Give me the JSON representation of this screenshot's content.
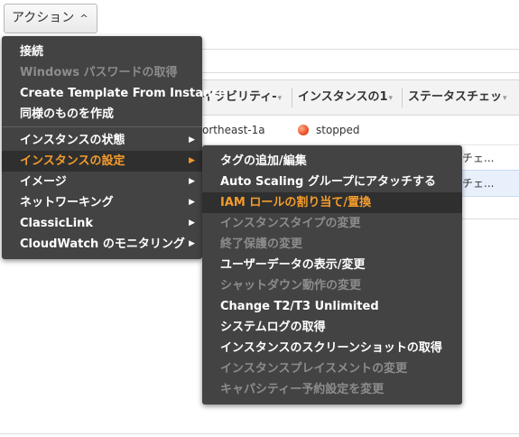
{
  "action_button": {
    "label": "アクション",
    "caret": "^"
  },
  "table": {
    "headers": [
      {
        "label": "イラビリティ-",
        "sort": "▾"
      },
      {
        "label": "インスタンスの1",
        "sort": "▾"
      },
      {
        "label": "ステータスチェッ",
        "sort": "▾"
      }
    ],
    "rows": [
      {
        "zone": "ortheast-1a",
        "state": "stopped",
        "status": ""
      },
      {
        "zone": "",
        "state": "",
        "status": "チェ..."
      },
      {
        "zone": "",
        "state": "",
        "status": "チェ..."
      }
    ]
  },
  "main_menu": {
    "items": [
      {
        "label": "接続",
        "enabled": true,
        "submenu": false
      },
      {
        "label": "Windows パスワードの取得",
        "enabled": false,
        "submenu": false
      },
      {
        "label": "Create Template From Instance",
        "enabled": true,
        "submenu": false
      },
      {
        "label": "同様のものを作成",
        "enabled": true,
        "submenu": false
      },
      {
        "label": "インスタンスの状態",
        "enabled": true,
        "submenu": true
      },
      {
        "label": "インスタンスの設定",
        "enabled": true,
        "submenu": true,
        "active": true
      },
      {
        "label": "イメージ",
        "enabled": true,
        "submenu": true
      },
      {
        "label": "ネットワーキング",
        "enabled": true,
        "submenu": true
      },
      {
        "label": "ClassicLink",
        "enabled": true,
        "submenu": true
      },
      {
        "label": "CloudWatch のモニタリング",
        "enabled": true,
        "submenu": true
      }
    ],
    "arrow": "▶"
  },
  "sub_menu": {
    "items": [
      {
        "label": "タグの追加/編集",
        "enabled": true
      },
      {
        "label": "Auto Scaling グループにアタッチする",
        "enabled": true
      },
      {
        "label": "IAM ロールの割り当て/置換",
        "enabled": true,
        "active": true
      },
      {
        "label": "インスタンスタイプの変更",
        "enabled": false
      },
      {
        "label": "終了保護の変更",
        "enabled": false
      },
      {
        "label": "ユーザーデータの表示/変更",
        "enabled": true
      },
      {
        "label": "シャットダウン動作の変更",
        "enabled": false
      },
      {
        "label": "Change T2/T3 Unlimited",
        "enabled": true
      },
      {
        "label": "システムログの取得",
        "enabled": true
      },
      {
        "label": "インスタンスのスクリーンショットの取得",
        "enabled": true
      },
      {
        "label": "インスタンスプレイスメントの変更",
        "enabled": false
      },
      {
        "label": "キャパシティー予約設定を変更",
        "enabled": false
      }
    ]
  },
  "colors": {
    "menu_bg": "#434343",
    "active_text": "#f39c2c",
    "disabled_text": "#8c8c8c",
    "stopped_dot": "#e8431a"
  }
}
